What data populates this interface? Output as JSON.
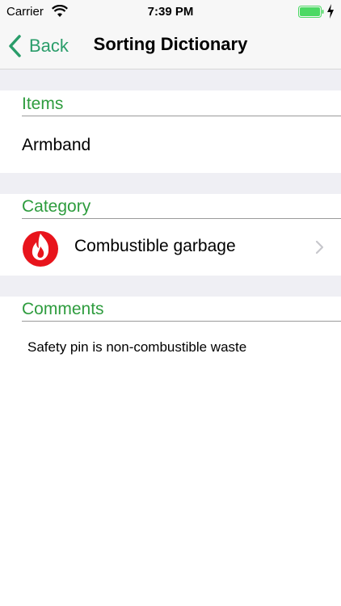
{
  "status_bar": {
    "carrier": "Carrier",
    "time": "7:39 PM"
  },
  "nav": {
    "back_label": "Back",
    "title": "Sorting Dictionary"
  },
  "sections": {
    "items": {
      "header": "Items",
      "value": "Armband"
    },
    "category": {
      "header": "Category",
      "value": "Combustible garbage",
      "icon": "fire-icon"
    },
    "comments": {
      "header": "Comments",
      "value": "Safety pin is non-combustible waste"
    }
  },
  "colors": {
    "accent_green": "#2e9c3e",
    "back_teal": "#2a9d6a",
    "fire_red": "#e8141c",
    "battery_green": "#4cd964"
  }
}
